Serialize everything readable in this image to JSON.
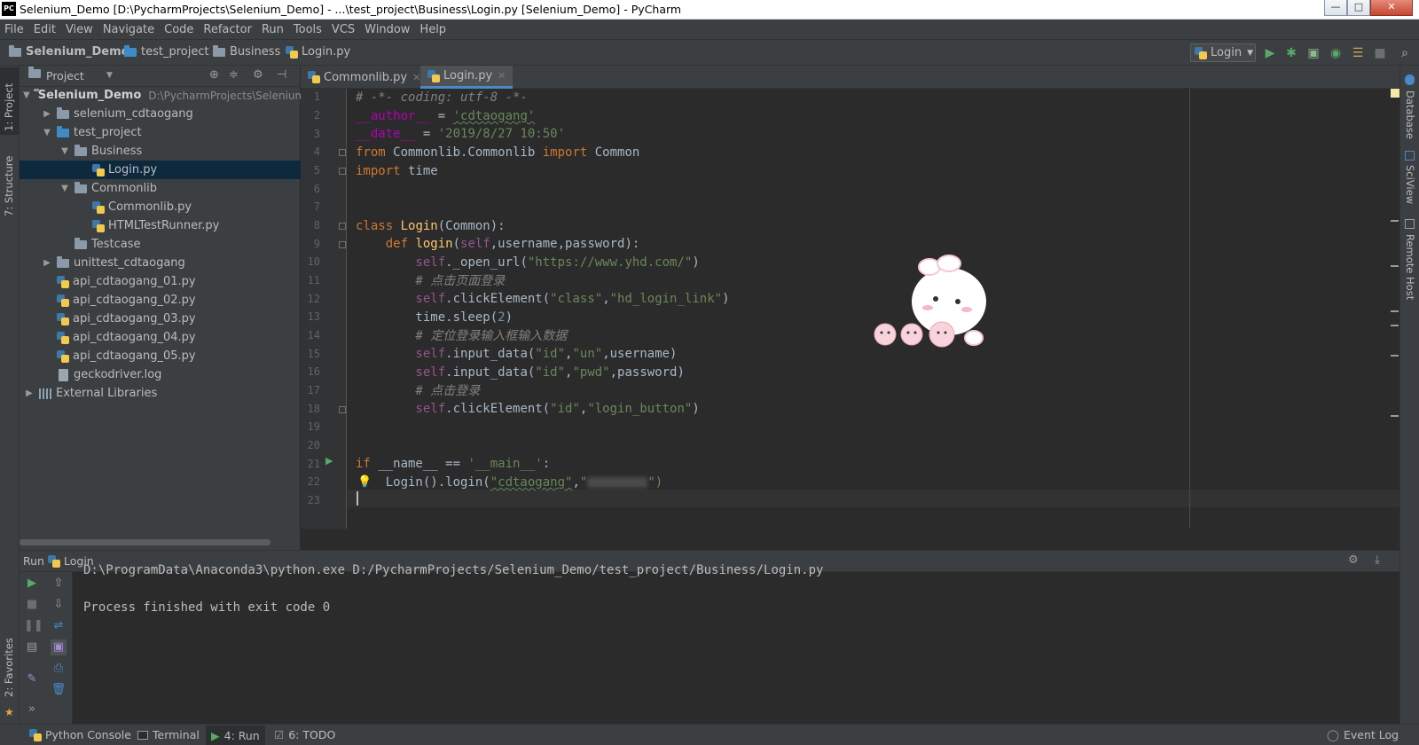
{
  "window": {
    "title": "Selenium_Demo [D:\\PycharmProjects\\Selenium_Demo] - ...\\test_project\\Business\\Login.py [Selenium_Demo] - PyCharm",
    "logo_text": "PC",
    "min": "—",
    "max": "□",
    "close": "✕"
  },
  "menu": [
    "File",
    "Edit",
    "View",
    "Navigate",
    "Code",
    "Refactor",
    "Run",
    "Tools",
    "VCS",
    "Window",
    "Help"
  ],
  "breadcrumbs": [
    "Selenium_Demo",
    "test_project",
    "Business",
    "Login.py"
  ],
  "toolbar": {
    "run_config": "Login",
    "icons": [
      "run-icon",
      "debug-icon",
      "coverage-icon",
      "profile-icon",
      "concurrency-icon",
      "stop-icon",
      "search-icon"
    ]
  },
  "left_tabs": [
    "1: Project",
    "7: Structure",
    "2: Favorites"
  ],
  "right_tabs": [
    "Database",
    "SciView",
    "Remote Host"
  ],
  "project": {
    "header": "Project",
    "root_name": "Selenium_Demo",
    "root_path": "D:\\PycharmProjects\\Selenium_",
    "tree": [
      {
        "label": "selenium_cdtaogang",
        "type": "folder",
        "arrow": "▶"
      },
      {
        "label": "test_project",
        "type": "folder-blue",
        "arrow": "▼"
      },
      {
        "label": "Business",
        "type": "folder",
        "arrow": "▼"
      },
      {
        "label": "Login.py",
        "type": "py",
        "arrow": ""
      },
      {
        "label": "Commonlib",
        "type": "folder",
        "arrow": "▼"
      },
      {
        "label": "Commonlib.py",
        "type": "py",
        "arrow": ""
      },
      {
        "label": "HTMLTestRunner.py",
        "type": "py",
        "arrow": ""
      },
      {
        "label": "Testcase",
        "type": "folder",
        "arrow": ""
      },
      {
        "label": "unittest_cdtaogang",
        "type": "folder",
        "arrow": "▶"
      },
      {
        "label": "api_cdtaogang_01.py",
        "type": "py",
        "arrow": ""
      },
      {
        "label": "api_cdtaogang_02.py",
        "type": "py",
        "arrow": ""
      },
      {
        "label": "api_cdtaogang_03.py",
        "type": "py",
        "arrow": ""
      },
      {
        "label": "api_cdtaogang_04.py",
        "type": "py",
        "arrow": ""
      },
      {
        "label": "api_cdtaogang_05.py",
        "type": "py",
        "arrow": ""
      },
      {
        "label": "geckodriver.log",
        "type": "log",
        "arrow": ""
      },
      {
        "label": "External Libraries",
        "type": "lib",
        "arrow": "▶"
      }
    ]
  },
  "editor": {
    "tabs": [
      {
        "label": "Commonlib.py",
        "close": "✕"
      },
      {
        "label": "Login.py",
        "close": "✕"
      }
    ],
    "line_numbers": [
      "1",
      "2",
      "3",
      "4",
      "5",
      "6",
      "7",
      "8",
      "9",
      "10",
      "11",
      "12",
      "13",
      "14",
      "15",
      "16",
      "17",
      "18",
      "19",
      "20",
      "21",
      "22",
      "23"
    ],
    "code": {
      "l1": "# -*- coding: utf-8 -*-",
      "l2a": "__author__",
      "l2b": " = ",
      "l2c": "'cdtaogang'",
      "l3a": "__date__",
      "l3b": " = ",
      "l3c": "'2019/8/27 10:50'",
      "l4a": "from",
      "l4b": " Commonlib.Commonlib ",
      "l4c": "import",
      "l4d": " Common",
      "l5a": "import",
      "l5b": " time",
      "l8a": "class",
      "l8b": " Login",
      "l8c": "(Common):",
      "l9a": "    def",
      "l9b": " login",
      "l9c": "(",
      "l9d": "self",
      "l9e": ",username,password):",
      "l10a": "        self",
      "l10b": "._open_url(",
      "l10c": "\"https://www.yhd.com/\"",
      "l10d": ")",
      "l11": "        # 点击页面登录",
      "l12a": "        self",
      "l12b": ".clickElement(",
      "l12c": "\"class\"",
      "l12d": ",",
      "l12e": "\"hd_login_link\"",
      "l12f": ")",
      "l13a": "        time.sleep(",
      "l13b": "2",
      "l13c": ")",
      "l14": "        # 定位登录输入框输入数据",
      "l15a": "        self",
      "l15b": ".input_data(",
      "l15c": "\"id\"",
      "l15d": ",",
      "l15e": "\"un\"",
      "l15f": ",username)",
      "l16a": "        self",
      "l16b": ".input_data(",
      "l16c": "\"id\"",
      "l16d": ",",
      "l16e": "\"pwd\"",
      "l16f": ",password)",
      "l17": "        # 点击登录",
      "l18a": "        self",
      "l18b": ".clickElement(",
      "l18c": "\"id\"",
      "l18d": ",",
      "l18e": "\"login_button\"",
      "l18f": ")",
      "l21a": "if",
      "l21b": " __name__ ",
      "l21c": "==",
      "l21d": " ",
      "l21e": "'__main__'",
      "l21f": ":",
      "l22a": "    Login().login(",
      "l22b": "\"cdtaogang\"",
      "l22c": ",",
      "l22d": "\"",
      "l22e": "\")"
    }
  },
  "run": {
    "header_label": "Run",
    "config": "Login",
    "output": [
      "D:\\ProgramData\\Anaconda3\\python.exe D:/PycharmProjects/Selenium_Demo/test_project/Business/Login.py",
      "",
      "Process finished with exit code 0"
    ]
  },
  "statusbar": {
    "items": [
      "Python Console",
      "Terminal",
      "4: Run",
      "6: TODO"
    ],
    "event_log": "Event Log"
  },
  "colors": {
    "background": "#2b2b2b",
    "panel": "#3c3f41",
    "keyword": "#cc7832",
    "string": "#6a8759",
    "function": "#ffc66d",
    "accent": "#4a88c7",
    "run_green": "#59a869"
  }
}
